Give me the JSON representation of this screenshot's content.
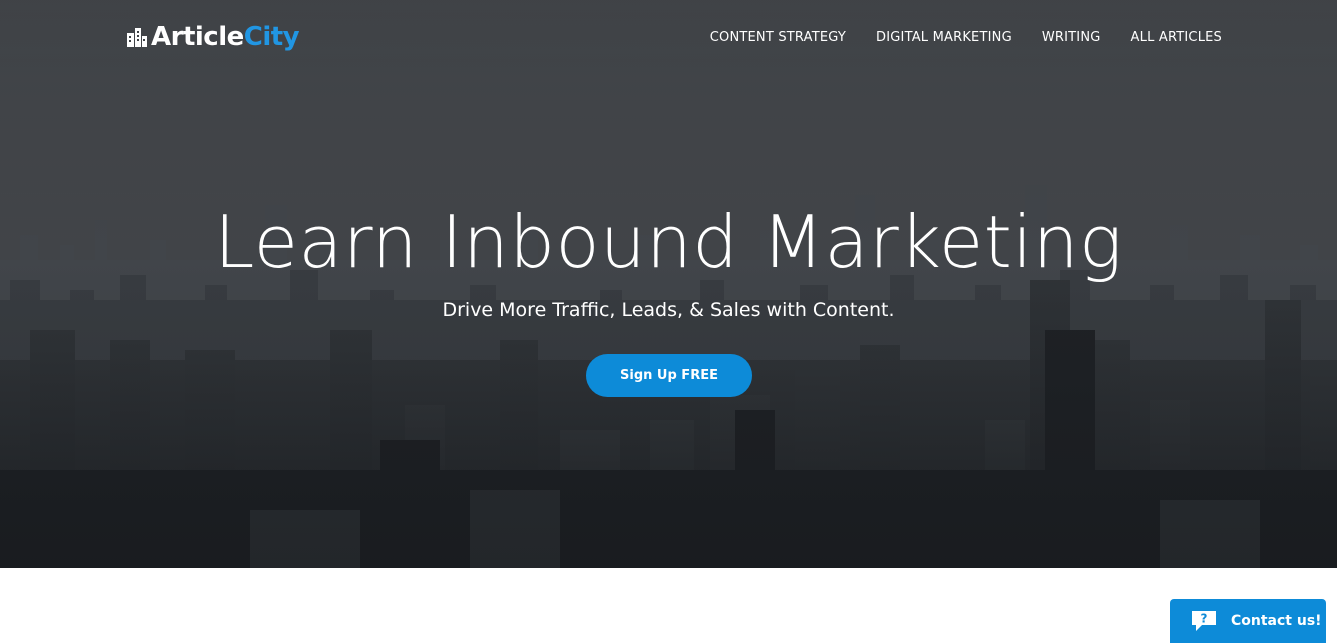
{
  "header": {
    "logo": {
      "part1": "Article",
      "part2": "City",
      "accent_color": "#2196e3"
    },
    "nav": [
      {
        "label": "CONTENT STRATEGY"
      },
      {
        "label": "DIGITAL MARKETING"
      },
      {
        "label": "WRITING"
      },
      {
        "label": "ALL ARTICLES"
      }
    ]
  },
  "hero": {
    "title": "Learn Inbound Marketing",
    "subtitle": "Drive More Traffic, Leads, & Sales with Content.",
    "cta_label": "Sign Up FREE",
    "cta_color": "#0d8bd8",
    "background": "city-skyline-photo"
  },
  "contact_widget": {
    "label": "Contact us!",
    "icon": "chat-bubble-question-icon",
    "color": "#0d8bd8"
  }
}
